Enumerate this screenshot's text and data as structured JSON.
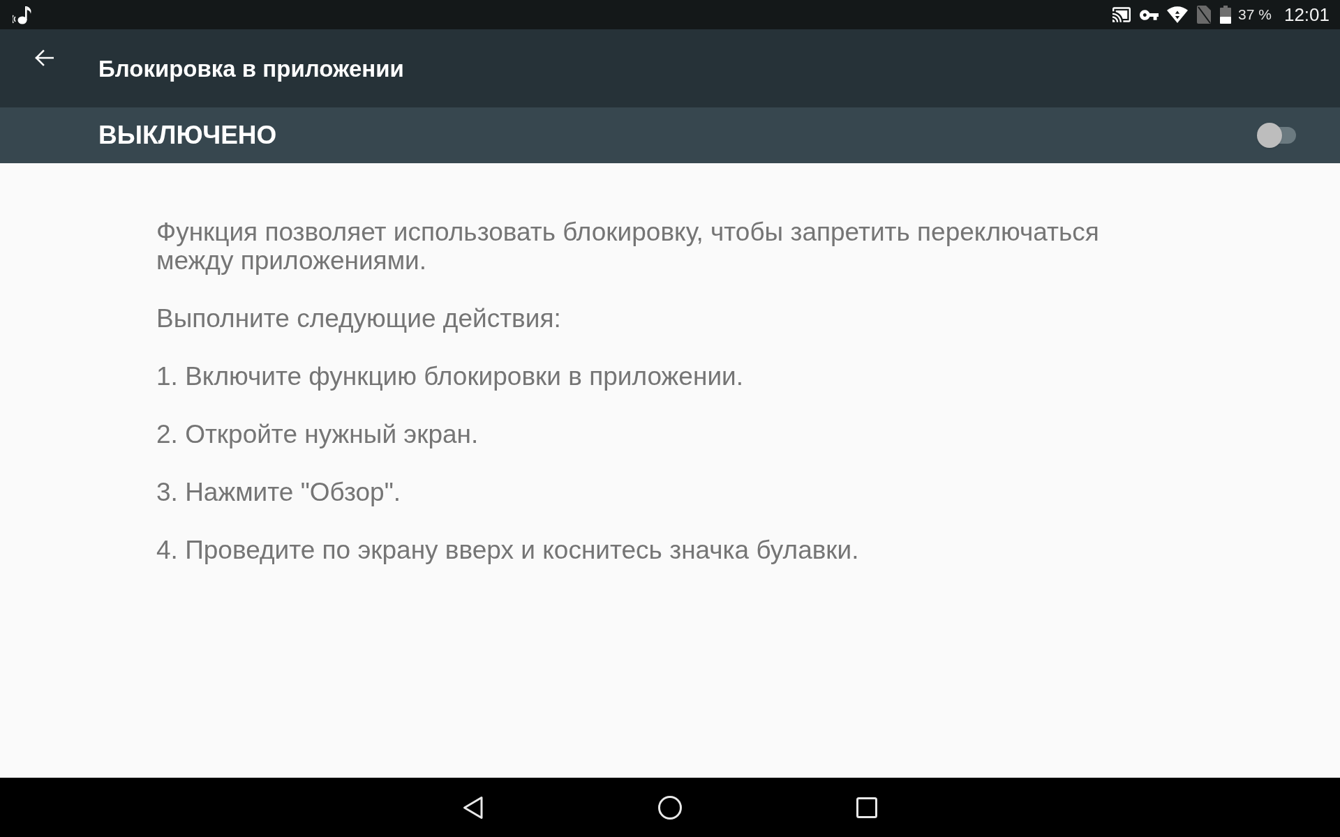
{
  "status_bar": {
    "battery_percent": "37 %",
    "time": "12:01"
  },
  "app_bar": {
    "title": "Блокировка в приложении"
  },
  "switch_bar": {
    "label": "ВЫКЛЮЧЕНО",
    "on": false
  },
  "content": {
    "description": "Функция позволяет использовать блокировку, чтобы запретить переключаться между приложениями.",
    "instructions_heading": "Выполните следующие действия:",
    "steps": [
      "1. Включите функцию блокировки в приложении.",
      "2. Откройте нужный экран.",
      "3. Нажмите \"Обзор\".",
      "4. Проведите по экрану вверх и коснитесь значка булавки."
    ]
  }
}
